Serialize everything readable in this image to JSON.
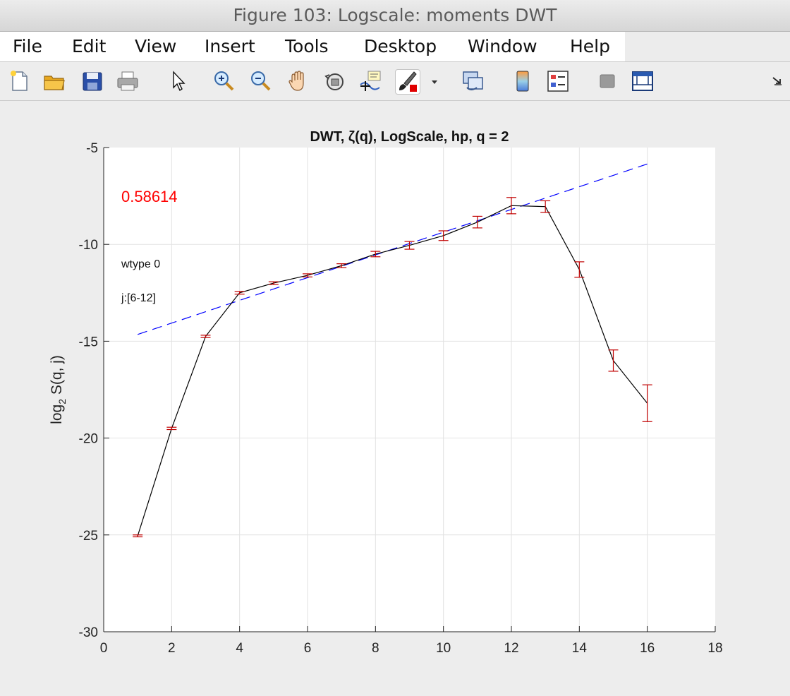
{
  "window": {
    "title": "Figure 103: Logscale: moments DWT"
  },
  "menu": [
    "File",
    "Edit",
    "View",
    "Insert",
    "Tools",
    "Desktop",
    "Window",
    "Help"
  ],
  "toolbar": [
    {
      "name": "new-figure-icon"
    },
    {
      "name": "open-file-icon"
    },
    {
      "name": "save-icon"
    },
    {
      "name": "print-icon"
    },
    {
      "name": "edit-plot-arrow-icon"
    },
    {
      "name": "zoom-in-icon"
    },
    {
      "name": "zoom-out-icon"
    },
    {
      "name": "pan-hand-icon"
    },
    {
      "name": "rotate-3d-icon"
    },
    {
      "name": "data-cursor-icon"
    },
    {
      "name": "brush-icon"
    },
    {
      "name": "brush-dropdown-icon"
    },
    {
      "name": "link-plot-icon"
    },
    {
      "name": "insert-colorbar-icon"
    },
    {
      "name": "insert-legend-icon"
    },
    {
      "name": "hide-plot-tools-icon"
    },
    {
      "name": "show-plot-tools-icon"
    },
    {
      "name": "dock-figure-icon"
    }
  ],
  "chart_data": {
    "type": "line",
    "title": "DWT, ζ(q), LogScale, hp, q = 2",
    "xlabel": "",
    "ylabel": "log",
    "ylabel_sub": "2",
    "ylabel_rest": " S(q, j)",
    "xlim": [
      0,
      18
    ],
    "ylim": [
      -30,
      -5
    ],
    "xticks": [
      0,
      2,
      4,
      6,
      8,
      10,
      12,
      14,
      16,
      18
    ],
    "yticks": [
      -5,
      -10,
      -15,
      -20,
      -25,
      -30
    ],
    "grid": true,
    "annotations": {
      "slope": "0.58614",
      "wtype": "wtype 0",
      "range": "j:[6-12]"
    },
    "colors": {
      "data": "#000000",
      "errorbar": "#c00000",
      "fit": "#0000ff",
      "slope_text": "#ff0000"
    },
    "series": [
      {
        "x": [
          1,
          2,
          3,
          4,
          5,
          6,
          7,
          8,
          9,
          10,
          11,
          12,
          13,
          14,
          15,
          16
        ],
        "y": [
          -25.05,
          -19.5,
          -14.75,
          -12.5,
          -12.0,
          -11.6,
          -11.1,
          -10.5,
          -10.05,
          -9.55,
          -8.85,
          -8.0,
          -8.05,
          -11.3,
          -16.0,
          -18.2
        ],
        "err": [
          0.05,
          0.06,
          0.06,
          0.07,
          0.07,
          0.08,
          0.1,
          0.14,
          0.2,
          0.25,
          0.3,
          0.42,
          0.3,
          0.4,
          0.55,
          0.95
        ]
      }
    ],
    "fit": {
      "x": [
        1,
        16
      ],
      "y": [
        -14.65,
        -5.85
      ]
    }
  }
}
